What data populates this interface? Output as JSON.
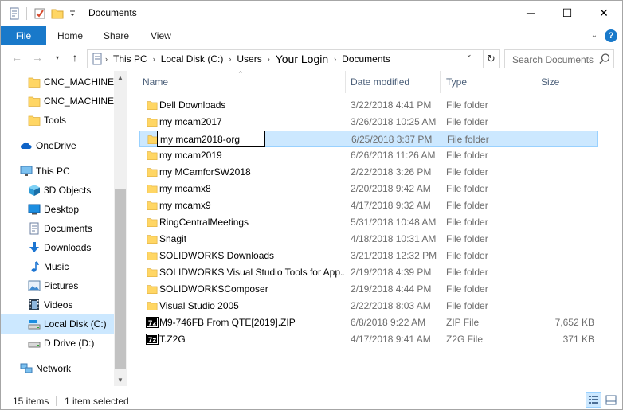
{
  "window": {
    "title": "Documents",
    "minimize_glyph": "─",
    "maximize_glyph": "☐",
    "close_glyph": "✕"
  },
  "ribbon": {
    "file_tab": "File",
    "tabs": [
      "Home",
      "Share",
      "View"
    ]
  },
  "address": {
    "crumbs": [
      "This PC",
      "Local Disk (C:)",
      "Users",
      "Your Login",
      "Documents"
    ],
    "search_placeholder": "Search Documents"
  },
  "nav_pane": {
    "items": [
      {
        "label": "CNC_MACHINES",
        "icon": "folder-icon"
      },
      {
        "label": "CNC_MACHINES",
        "icon": "folder-icon"
      },
      {
        "label": "Tools",
        "icon": "folder-icon"
      },
      {
        "label": "OneDrive",
        "icon": "onedrive-icon"
      },
      {
        "label": "This PC",
        "icon": "this-pc-icon"
      },
      {
        "label": "3D Objects",
        "icon": "3d-objects-icon"
      },
      {
        "label": "Desktop",
        "icon": "desktop-icon"
      },
      {
        "label": "Documents",
        "icon": "documents-icon"
      },
      {
        "label": "Downloads",
        "icon": "downloads-icon"
      },
      {
        "label": "Music",
        "icon": "music-icon"
      },
      {
        "label": "Pictures",
        "icon": "pictures-icon"
      },
      {
        "label": "Videos",
        "icon": "videos-icon"
      },
      {
        "label": "Local Disk (C:)",
        "icon": "local-disk-icon",
        "selected": true
      },
      {
        "label": "D Drive (D:)",
        "icon": "drive-icon"
      },
      {
        "label": "Network",
        "icon": "network-icon"
      }
    ]
  },
  "file_list": {
    "columns": {
      "name": "Name",
      "date": "Date modified",
      "type": "Type",
      "size": "Size"
    },
    "rows": [
      {
        "name": "Dell Downloads",
        "date": "3/22/2018 4:41 PM",
        "type": "File folder",
        "size": "",
        "icon": "folder-icon"
      },
      {
        "name": "my mcam2017",
        "date": "3/26/2018 10:25 AM",
        "type": "File folder",
        "size": "",
        "icon": "folder-icon"
      },
      {
        "name": "my mcam2018-org",
        "date": "6/25/2018 3:37 PM",
        "type": "File folder",
        "size": "",
        "icon": "folder-icon",
        "selected": true,
        "renaming": true
      },
      {
        "name": "my mcam2019",
        "date": "6/26/2018 11:26 AM",
        "type": "File folder",
        "size": "",
        "icon": "folder-icon"
      },
      {
        "name": "my MCamforSW2018",
        "date": "2/22/2018 3:26 PM",
        "type": "File folder",
        "size": "",
        "icon": "folder-icon"
      },
      {
        "name": "my mcamx8",
        "date": "2/20/2018 9:42 AM",
        "type": "File folder",
        "size": "",
        "icon": "folder-icon"
      },
      {
        "name": "my mcamx9",
        "date": "4/17/2018 9:32 AM",
        "type": "File folder",
        "size": "",
        "icon": "folder-icon"
      },
      {
        "name": "RingCentralMeetings",
        "date": "5/31/2018 10:48 AM",
        "type": "File folder",
        "size": "",
        "icon": "folder-icon"
      },
      {
        "name": "Snagit",
        "date": "4/18/2018 10:31 AM",
        "type": "File folder",
        "size": "",
        "icon": "folder-icon"
      },
      {
        "name": "SOLIDWORKS Downloads",
        "date": "3/21/2018 12:32 PM",
        "type": "File folder",
        "size": "",
        "icon": "folder-icon"
      },
      {
        "name": "SOLIDWORKS Visual Studio Tools for App...",
        "date": "2/19/2018 4:39 PM",
        "type": "File folder",
        "size": "",
        "icon": "folder-icon"
      },
      {
        "name": "SOLIDWORKSComposer",
        "date": "2/19/2018 4:44 PM",
        "type": "File folder",
        "size": "",
        "icon": "folder-icon"
      },
      {
        "name": "Visual Studio 2005",
        "date": "2/22/2018 8:03 AM",
        "type": "File folder",
        "size": "",
        "icon": "folder-icon"
      },
      {
        "name": "M9-746FB From QTE[2019].ZIP",
        "date": "6/8/2018 9:22 AM",
        "type": "ZIP File",
        "size": "7,652 KB",
        "icon": "7zip-archive-icon"
      },
      {
        "name": "T.Z2G",
        "date": "4/17/2018 9:41 AM",
        "type": "Z2G File",
        "size": "371 KB",
        "icon": "7zip-archive-icon"
      }
    ]
  },
  "status": {
    "item_count": "15 items",
    "selection": "1 item selected"
  },
  "colors": {
    "accent": "#1979ca",
    "selection_bg": "#cce8ff",
    "selection_border": "#99d1ff",
    "folder_yellow": "#ffd664"
  }
}
